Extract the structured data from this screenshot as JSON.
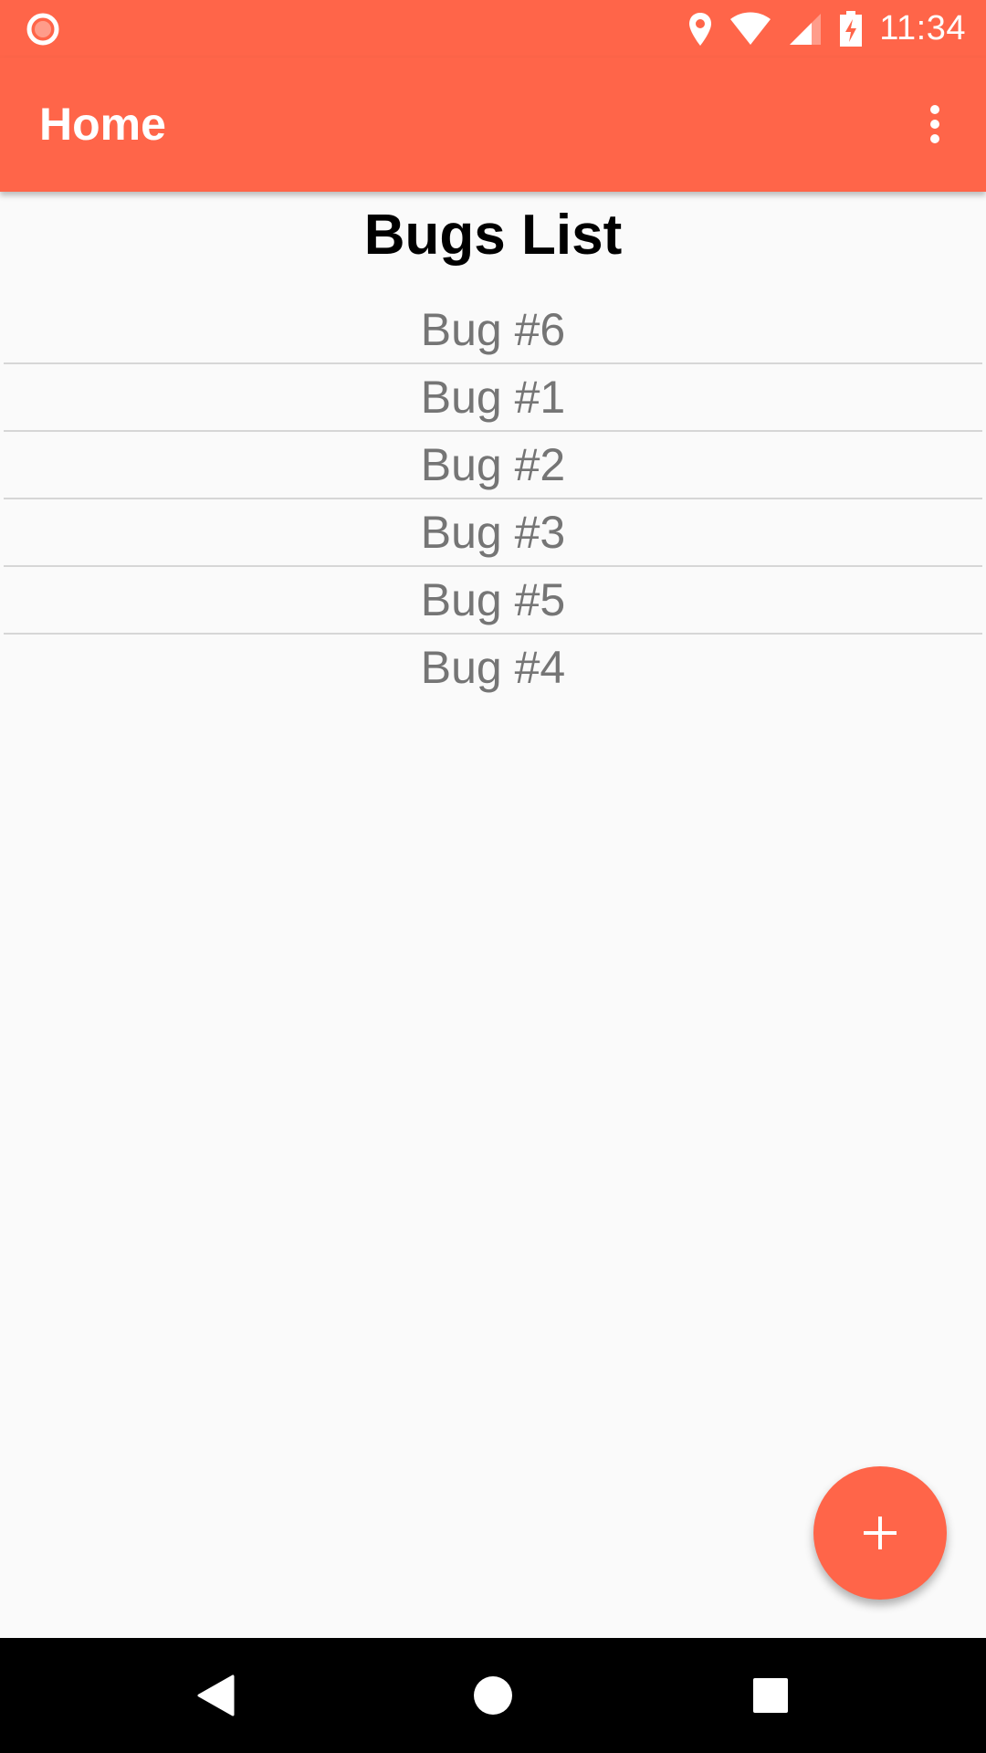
{
  "status_bar": {
    "time": "11:34",
    "left_icon": "record-indicator-icon",
    "right_icons": [
      "location-icon",
      "wifi-icon",
      "cellular-signal-icon",
      "battery-charging-icon"
    ]
  },
  "app_bar": {
    "title": "Home",
    "overflow_icon": "more-vert-icon"
  },
  "main": {
    "heading": "Bugs List",
    "items": [
      {
        "label": "Bug #6"
      },
      {
        "label": "Bug #1"
      },
      {
        "label": "Bug #2"
      },
      {
        "label": "Bug #3"
      },
      {
        "label": "Bug #5"
      },
      {
        "label": "Bug #4"
      }
    ]
  },
  "fab": {
    "icon": "plus-icon"
  },
  "nav_bar": {
    "icons": [
      "back-icon",
      "home-icon",
      "recents-icon"
    ]
  },
  "colors": {
    "accent": "#ff6549",
    "background": "#fafafa",
    "item_text": "#757575",
    "divider": "#d6d6d6"
  }
}
